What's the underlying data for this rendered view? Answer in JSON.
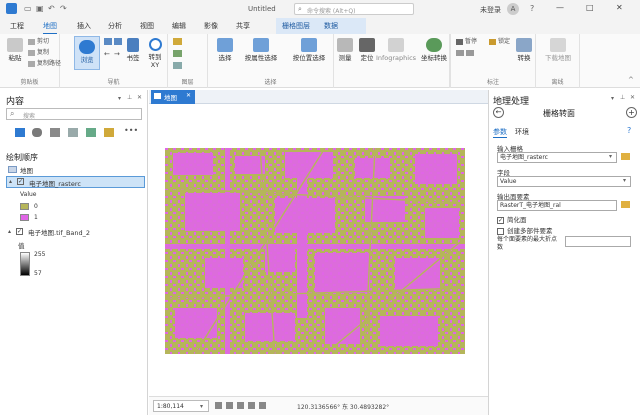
{
  "titlebar": {
    "title": "Untitled",
    "search_placeholder": "命令搜索 (Alt+Q)",
    "user": "未登录",
    "user_initial": "A",
    "help": "?",
    "minimize": "—",
    "maximize": "□",
    "close": "✕"
  },
  "context_tab": {
    "group": "栅格图层",
    "tab": "数据"
  },
  "tabs": [
    "工程",
    "地图",
    "插入",
    "分析",
    "视图",
    "编辑",
    "影像",
    "共享"
  ],
  "ribbon": {
    "clipboard": {
      "label": "剪贴板",
      "paste": "粘贴",
      "cut": "剪切",
      "copy": "复制",
      "copy_path": "复制路径"
    },
    "navigate": {
      "label": "导航",
      "explore": "浏览",
      "bookmarks": "书签",
      "goto": "转到 XY"
    },
    "layer": {
      "label": "图层",
      "basemap": "底图"
    },
    "selection": {
      "label": "选择",
      "select": "选择",
      "by_attr": "按属性选择",
      "by_loc": "按位置选择"
    },
    "inquiry": {
      "measure": "测量",
      "locate": "定位",
      "infographics": "Infographics",
      "coord_convert": "坐标转换"
    },
    "labeling": {
      "label": "标注",
      "pause": "暂停",
      "lock": "锁定",
      "convert": "转换"
    },
    "offline": {
      "label": "离线",
      "download": "下载地图"
    }
  },
  "contents": {
    "title": "内容",
    "search_placeholder": "搜索",
    "drawing_order": "绘制顺序",
    "map": "地图",
    "layer1": {
      "name": "电子地图_rasterc",
      "field": "Value",
      "classes": [
        {
          "label": "0",
          "color": "#b5b55a"
        },
        {
          "label": "1",
          "color": "#e066e6"
        }
      ]
    },
    "layer2": {
      "name": "电子地图.tif_Band_2",
      "value_label": "值",
      "max": "255",
      "min": "57"
    }
  },
  "map": {
    "tab": "地图",
    "scale": "1:80,114",
    "coords": "120.3136566° 东 30.4893282°",
    "colors": {
      "background": "#b5b55a",
      "foreground": "#e066e6"
    }
  },
  "geoprocessing": {
    "title": "地理处理",
    "tool": "栅格转面",
    "tabs": [
      "参数",
      "环境"
    ],
    "input_label": "输入栅格",
    "input_value": "电子地图_rasterc",
    "field_label": "字段",
    "field_value": "Value",
    "output_label": "输出面要素",
    "output_value": "RasterT_电子地图_ral",
    "simplify": "简化面",
    "multipart": "创建多部件要素",
    "max_vertices": "每个面要素的最大折点数"
  }
}
